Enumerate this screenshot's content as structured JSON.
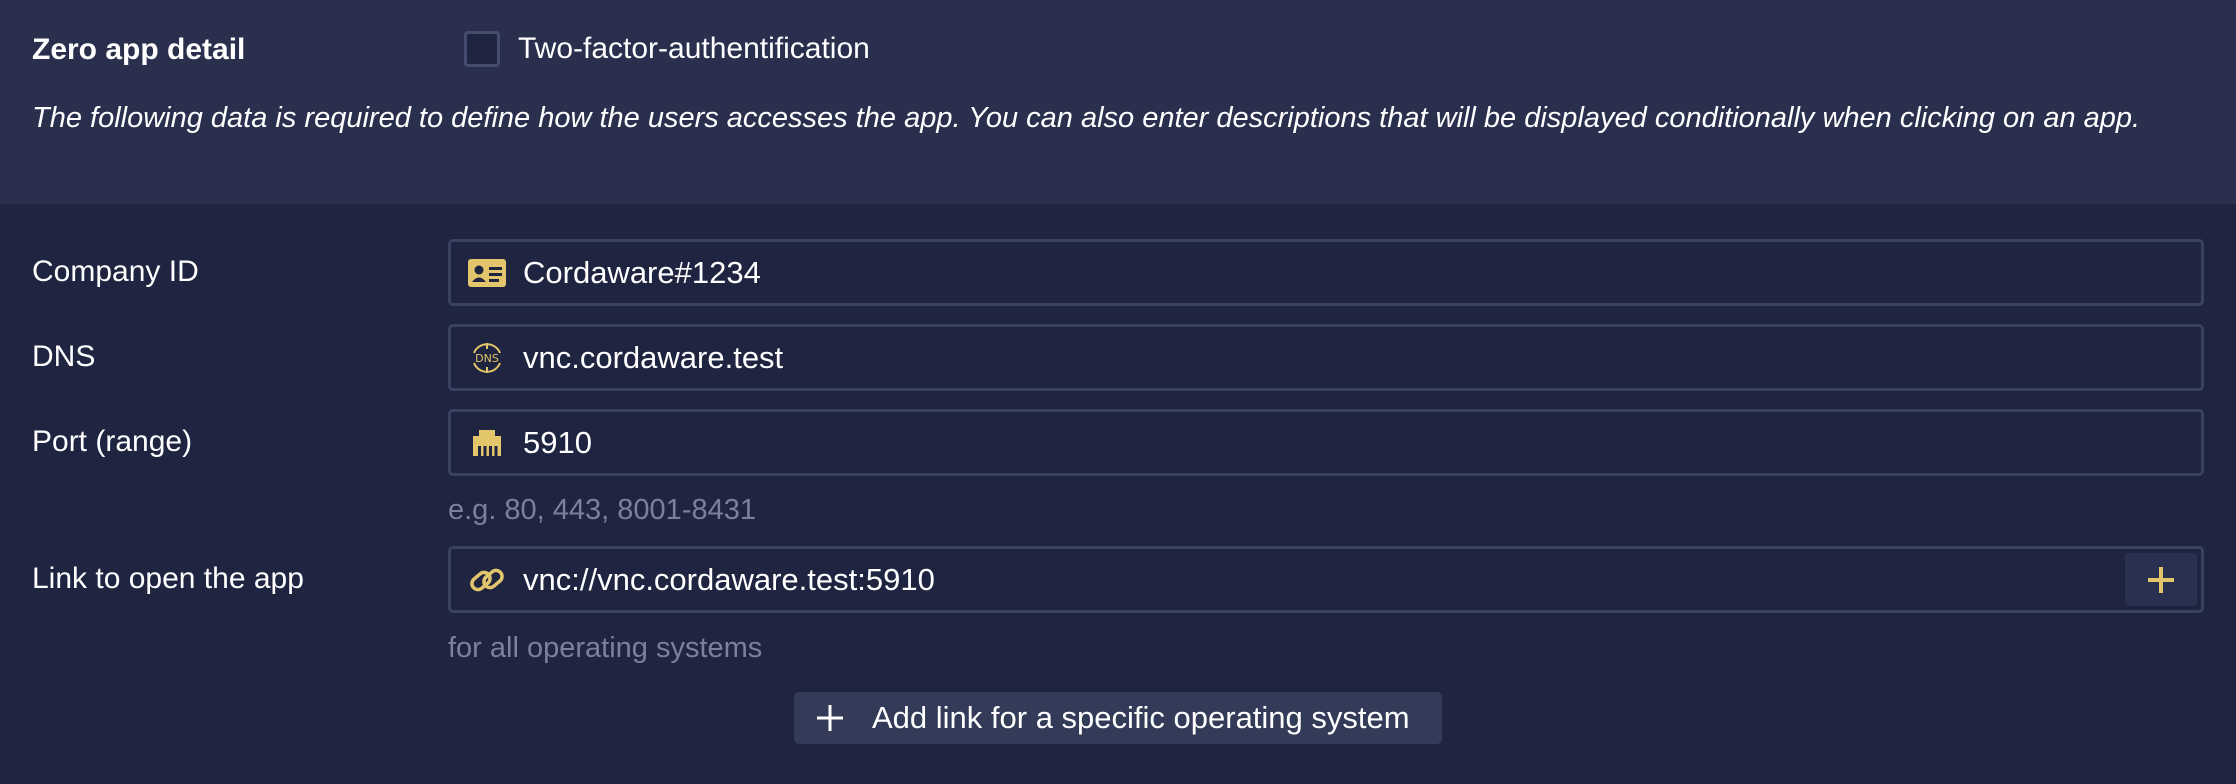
{
  "header": {
    "title": "Zero app detail",
    "two_factor_label": "Two-factor-authentification",
    "two_factor_checked": false,
    "description": "The following data is required to define how the users accesses the app. You can also enter descriptions that will be displayed conditionally when clicking on an app."
  },
  "fields": {
    "company_id": {
      "label": "Company ID",
      "value": "Cordaware#1234",
      "icon": "id-card-icon"
    },
    "dns": {
      "label": "DNS",
      "value": "vnc.cordaware.test",
      "icon": "dns-icon",
      "icon_text": "DNS"
    },
    "port": {
      "label": "Port (range)",
      "value": "5910",
      "icon": "ethernet-port-icon",
      "hint": "e.g. 80, 443, 8001-8431"
    },
    "link": {
      "label": "Link to open the app",
      "value": "vnc://vnc.cordaware.test:5910",
      "icon": "link-icon",
      "hint": "for all operating systems"
    }
  },
  "actions": {
    "add_os_link_label": "Add link for a specific operating system"
  },
  "colors": {
    "background": "#1f2440",
    "header_background": "#292f4d",
    "accent": "#e3c56b",
    "border": "#3a4262",
    "hint_text": "#7b8199"
  }
}
